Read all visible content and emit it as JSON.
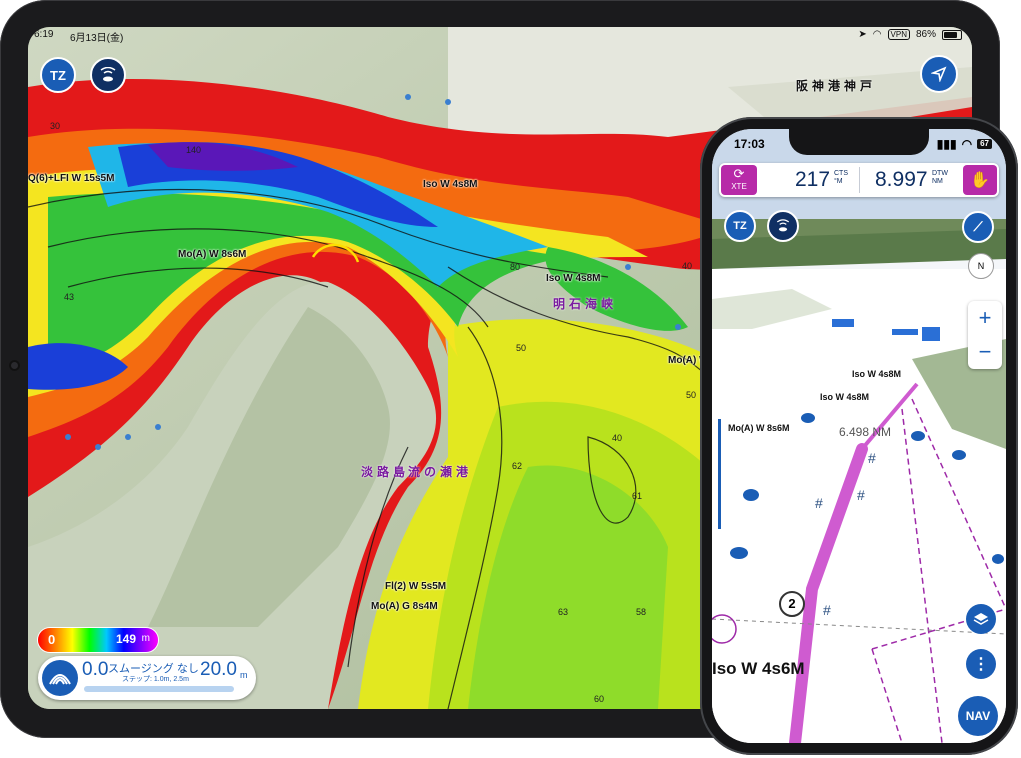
{
  "tablet": {
    "status": {
      "time": "6:19",
      "date": "6月13日(金)",
      "vpn": "VPN",
      "battery": "86%"
    },
    "buttons": {
      "tz": "TZ"
    },
    "map_labels": [
      "Q(6)+LFI W 15s5M",
      "Iso W 4s8M",
      "Mo(A) W 8s6M",
      "Iso W 4s8M",
      "Mo(A) W",
      "Fl(2) W 5s5M",
      "Mo(A) G 8s4M"
    ],
    "depth_numbers": [
      "140",
      "50",
      "43",
      "80",
      "50",
      "62",
      "63",
      "58",
      "60",
      "30",
      "40",
      "40",
      "61"
    ],
    "place_labels": [
      "阪神港神戸",
      "明石海峡",
      "淡路島",
      "流の瀬港"
    ],
    "depth_legend": {
      "min": "0",
      "max": "149",
      "unit": "m"
    },
    "smoothing": {
      "lo": "0.0",
      "hi": "20.0",
      "unit": "m",
      "title": "スムージング なし",
      "step": "ステップ: 1.0m, 2.5m"
    }
  },
  "phone": {
    "status": {
      "time": "17:03",
      "battery": "67"
    },
    "nav_bar": {
      "xte_label": "XTE",
      "cts_value": "217",
      "cts_unit_top": "CTS",
      "cts_unit_bottom": "°M",
      "dtw_value": "8.997",
      "dtw_unit_top": "DTW",
      "dtw_unit_bottom": "NM"
    },
    "buttons": {
      "tz": "TZ",
      "nav": "NAV",
      "zoom_in": "+",
      "zoom_out": "−",
      "compass": "N"
    },
    "map_labels": [
      "Iso W 4s8M",
      "Iso W 4s8M",
      "Mo(A) W 8s6M",
      "Iso W 4s6M"
    ],
    "distance": "6.498 NM",
    "waypoint": "2"
  },
  "colors": {
    "accent_blue": "#1a5db5",
    "route_magenta": "#b72aa8",
    "navy": "#0f2f63"
  }
}
